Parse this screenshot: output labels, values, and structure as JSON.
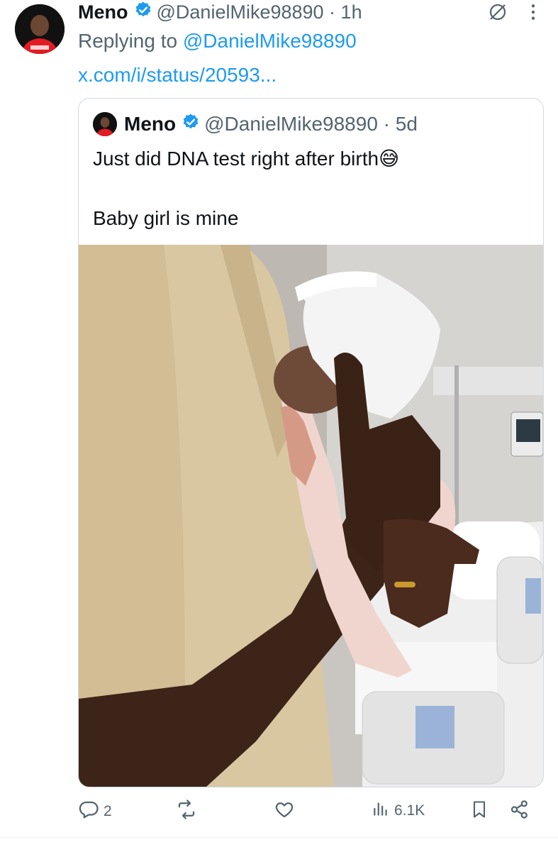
{
  "tweet": {
    "author_name": "Meno",
    "handle": "@DanielMike98890",
    "time": "1h",
    "replying_prefix": "Replying to",
    "replying_handle": "@DanielMike98890",
    "status_link": "x.com/i/status/20593..."
  },
  "quote": {
    "author_name": "Meno",
    "handle": "@DanielMike98890",
    "time": "5d",
    "text_line1": "Just did DNA test right after birth😅",
    "text_line2": "Baby girl is mine"
  },
  "actions": {
    "reply_count": "2",
    "views_count": "6.1K"
  },
  "colors": {
    "accent": "#1d9bf0",
    "muted": "#536471",
    "border": "#cfd9de"
  },
  "icons": [
    "verified-badge-icon",
    "grok-icon",
    "more-icon",
    "reply-icon",
    "retweet-icon",
    "like-icon",
    "views-icon",
    "bookmark-icon",
    "share-icon"
  ]
}
